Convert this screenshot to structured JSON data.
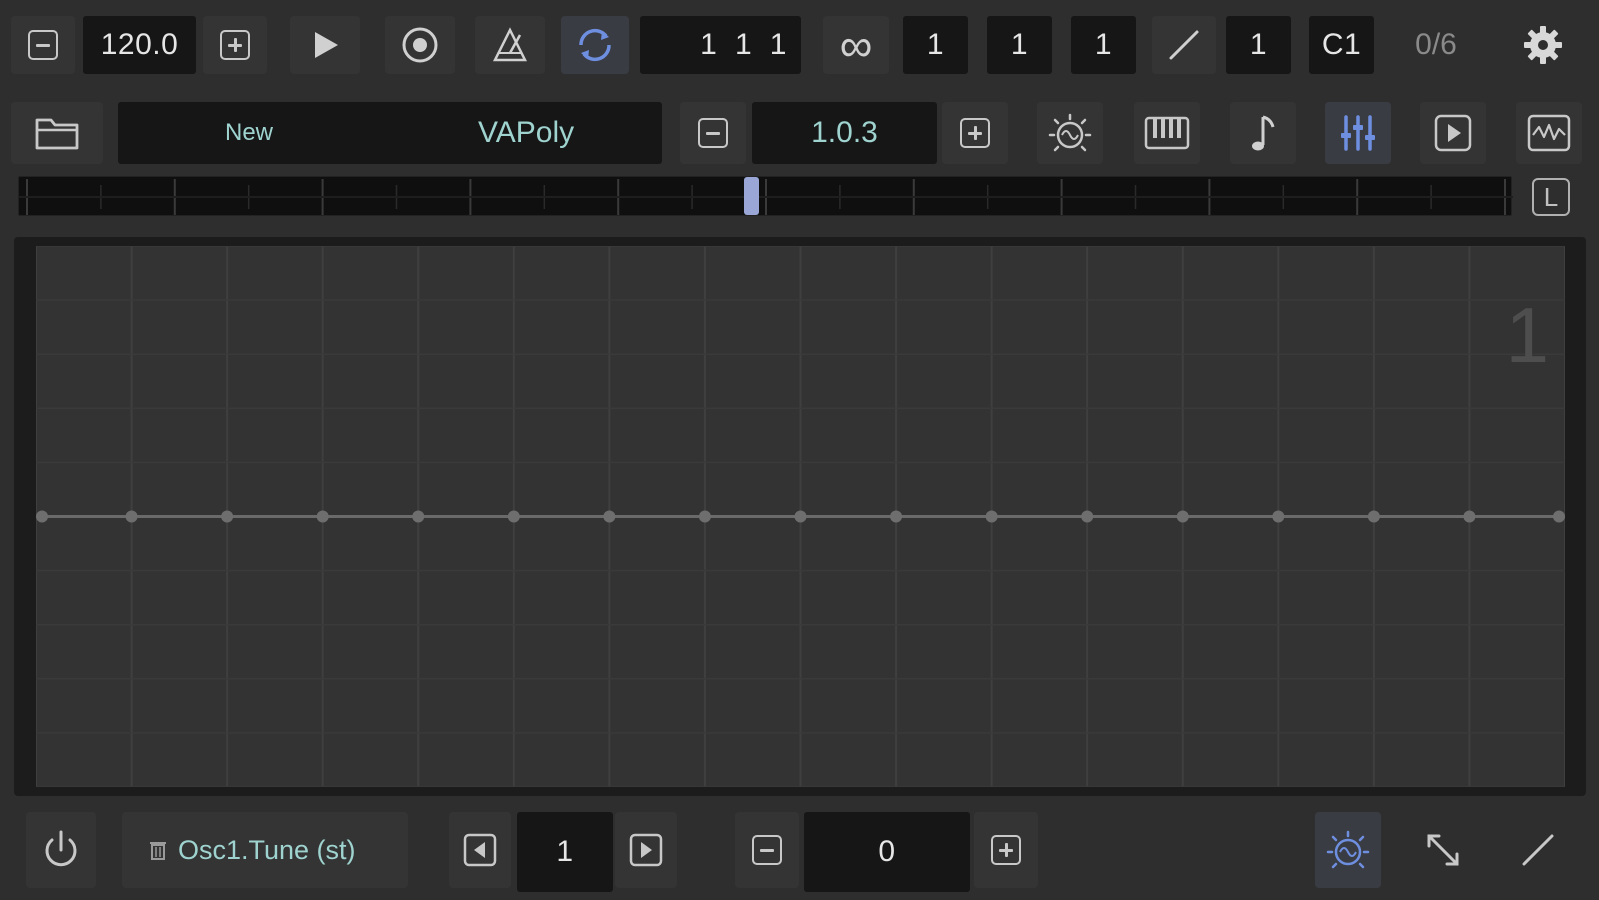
{
  "transport": {
    "tempo": "120.0",
    "position": "1  1  1",
    "loop_symbol": "∞",
    "field_1": "1",
    "field_2": "1",
    "field_3": "1",
    "field_4": "1",
    "note": "C1",
    "counter": "0/6"
  },
  "preset": {
    "name_left": "New",
    "name_right": "VAPoly",
    "version": "1.0.3"
  },
  "ruler": {
    "lock_label": "L",
    "playhead_fraction": 0.49
  },
  "graph": {
    "page_number": "1",
    "columns": 16,
    "rows": 10,
    "node_level": 0.5,
    "node_count": 17
  },
  "bottom": {
    "parameter": "Osc1.Tune (st)",
    "step": "1",
    "value": "0"
  },
  "colors": {
    "accent": "#6e8fe0",
    "teal": "#9fd3cf",
    "background": "#2e2e2e"
  }
}
